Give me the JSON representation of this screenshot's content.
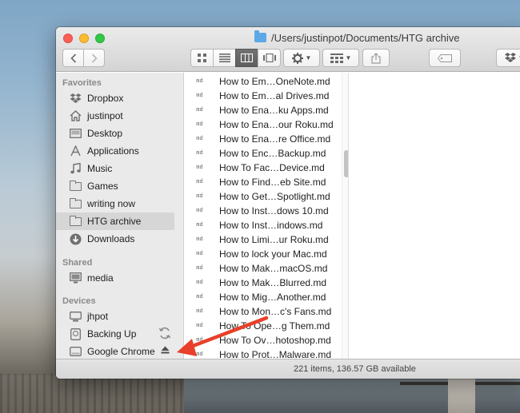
{
  "window": {
    "path_title": "/Users/justinpot/Documents/HTG archive"
  },
  "toolbar": {
    "back_icon": "chevron-left-icon",
    "forward_icon": "chevron-right-icon",
    "view_modes": [
      "icon-view-icon",
      "list-view-icon",
      "column-view-icon",
      "cover-flow-icon"
    ],
    "active_view": "column-view-icon"
  },
  "sidebar": {
    "favorites_heading": "Favorites",
    "favorites": [
      {
        "label": "Dropbox",
        "icon": "dropbox-icon"
      },
      {
        "label": "justinpot",
        "icon": "home-icon"
      },
      {
        "label": "Desktop",
        "icon": "desktop-icon"
      },
      {
        "label": "Applications",
        "icon": "applications-icon"
      },
      {
        "label": "Music",
        "icon": "music-icon"
      },
      {
        "label": "Games",
        "icon": "folder-icon"
      },
      {
        "label": "writing now",
        "icon": "folder-icon"
      },
      {
        "label": "HTG archive",
        "icon": "folder-icon",
        "selected": true
      },
      {
        "label": "Downloads",
        "icon": "downloads-icon"
      }
    ],
    "shared_heading": "Shared",
    "shared": [
      {
        "label": "media",
        "icon": "display-icon"
      }
    ],
    "devices_heading": "Devices",
    "devices": [
      {
        "label": "jhpot",
        "icon": "computer-icon"
      },
      {
        "label": "Backing Up",
        "icon": "time-machine-disk-icon",
        "trailing": "sync-icon"
      },
      {
        "label": "Google Chrome",
        "icon": "disk-icon",
        "trailing": "eject-icon"
      }
    ]
  },
  "files": [
    "How to Em…OneNote.md",
    "How to Em…al Drives.md",
    "How to Ena…ku Apps.md",
    "How to Ena…our Roku.md",
    "How to Ena…re Office.md",
    "How to Enc…Backup.md",
    "How To Fac…Device.md",
    "How to Find…eb Site.md",
    "How to Get…Spotlight.md",
    "How to Inst…dows 10.md",
    "How to Inst…indows.md",
    "How to Limi…ur Roku.md",
    "How to lock your Mac.md",
    "How to Mak…macOS.md",
    "How to Mak…Blurred.md",
    "How to Mig…Another.md",
    "How to Mon…c's Fans.md",
    "How To Ope…g Them.md",
    "How To Ov…hotoshop.md",
    "How to Prot…Malware.md"
  ],
  "file_icon_text": "md",
  "status": {
    "text": "221 items, 136.57 GB available"
  },
  "colors": {
    "annotation_arrow": "#e8402a",
    "selection": "#d6d6d6",
    "folder_title_icon": "#5da8e6"
  }
}
